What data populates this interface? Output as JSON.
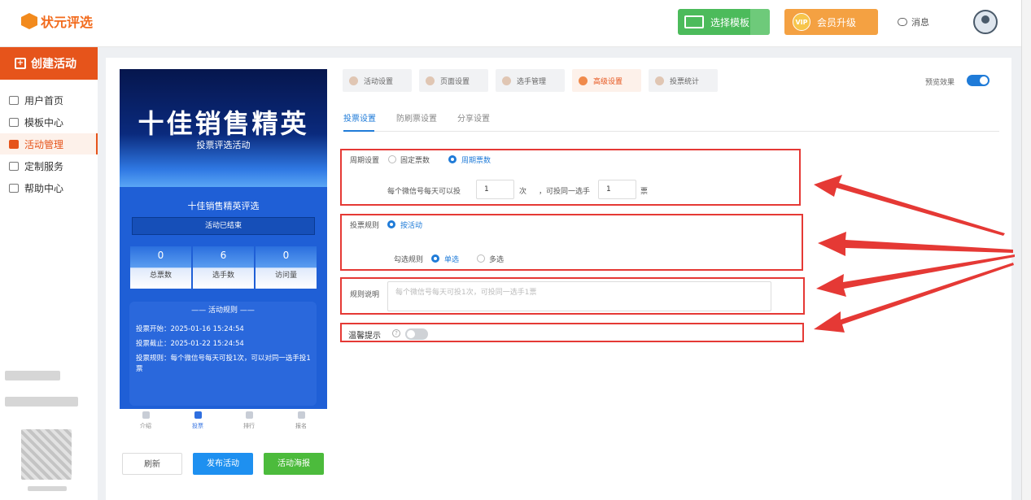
{
  "header": {
    "logo_text": "状元评选",
    "choose_template": "选择模板",
    "vip_badge": "VIP",
    "vip_upgrade": "会员升级",
    "messages": "消息"
  },
  "sidebar": {
    "create": "创建活动",
    "items": [
      {
        "label": "用户首页"
      },
      {
        "label": "模板中心"
      },
      {
        "label": "活动管理"
      },
      {
        "label": "定制服务"
      },
      {
        "label": "帮助中心"
      }
    ]
  },
  "preview": {
    "banner_title": "十佳销售精英",
    "banner_sub": "投票评选活动",
    "activity_name": "十佳销售精英评选",
    "status": "活动已结束",
    "stats": [
      {
        "value": "0",
        "label": "总票数"
      },
      {
        "value": "6",
        "label": "选手数"
      },
      {
        "value": "0",
        "label": "访问量"
      }
    ],
    "rules_header": "—— 活动规则 ——",
    "rule_start": "投票开始：2025-01-16 15:24:54",
    "rule_end": "投票截止：2025-01-22 15:24:54",
    "rule_text": "投票规则：每个微信号每天可投1次，可以对同一选手投1票",
    "tabs": [
      "介绍",
      "投票",
      "排行",
      "报名"
    ],
    "btn_refresh": "刷新",
    "btn_publish": "发布活动",
    "btn_poster": "活动海报"
  },
  "settings": {
    "tabs": [
      "活动设置",
      "页面设置",
      "选手管理",
      "高级设置",
      "投票统计"
    ],
    "preview_label": "预览效果",
    "subtabs": [
      "投票设置",
      "防刷票设置",
      "分享设置"
    ],
    "period_label": "周期设置",
    "period_fixed": "固定票数",
    "period_cycle": "周期票数",
    "per_day_text": "每个微信号每天可以投",
    "per_day_value": "1",
    "times_text": "次",
    "same_player_text": "，可投同一选手",
    "same_player_value": "1",
    "votes_unit": "票",
    "rule_label": "投票规则",
    "rule_by_activity": "按活动",
    "select_rule_label": "勾选规则",
    "single": "单选",
    "multi": "多选",
    "desc_label": "规则说明",
    "desc_placeholder": "每个微信号每天可投1次，可投同一选手1票",
    "tips_label": "温馨提示",
    "help_glyph": "?"
  }
}
